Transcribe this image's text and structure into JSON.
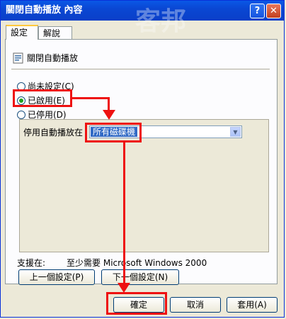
{
  "window": {
    "title": "關閉自動播放 內容",
    "help_glyph": "?",
    "close_glyph": "✕"
  },
  "watermark": "客邦",
  "tabs": [
    {
      "label": "設定"
    },
    {
      "label": "解說"
    }
  ],
  "policy": {
    "name": "關閉自動播放"
  },
  "radios": [
    {
      "label": "尚未設定(C)"
    },
    {
      "label": "已啟用(E)"
    },
    {
      "label": "已停用(D)"
    }
  ],
  "options": {
    "label": "停用自動播放在",
    "selected": "所有磁碟機"
  },
  "support": {
    "label": "支援在:",
    "value": "至少需要 Microsoft Windows 2000"
  },
  "nav": {
    "prev": "上一個設定(P)",
    "next": "下一個設定(N)"
  },
  "footer": {
    "ok": "確定",
    "cancel": "取消",
    "apply": "套用(A)"
  },
  "colors": {
    "title_bar": "#0a47d3",
    "highlight": "#ee1111",
    "selection": "#316ac5"
  }
}
